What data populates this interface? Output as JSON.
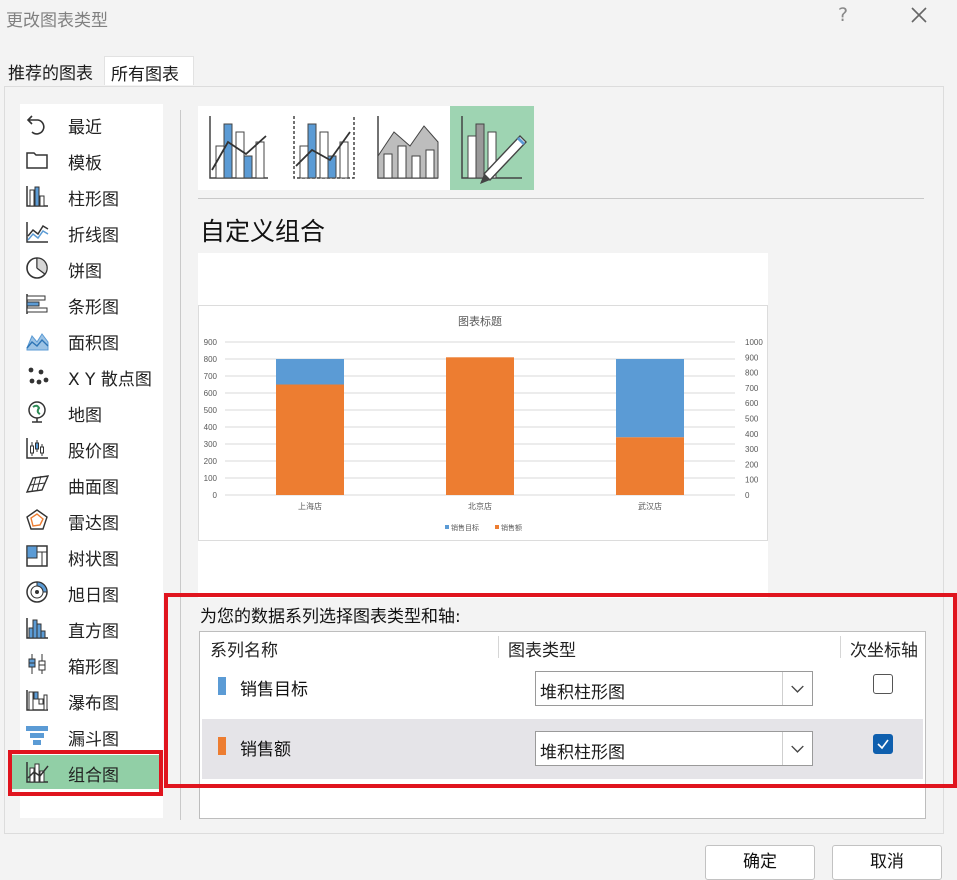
{
  "dialog": {
    "title": "更改图表类型",
    "help_label": "?"
  },
  "tabs": {
    "recommended": "推荐的图表",
    "all": "所有图表"
  },
  "categories": [
    {
      "label": "最近",
      "icon": "recent-icon"
    },
    {
      "label": "模板",
      "icon": "folder-icon"
    },
    {
      "label": "柱形图",
      "icon": "column-chart-icon"
    },
    {
      "label": "折线图",
      "icon": "line-chart-icon"
    },
    {
      "label": "饼图",
      "icon": "pie-chart-icon"
    },
    {
      "label": "条形图",
      "icon": "bar-chart-icon"
    },
    {
      "label": "面积图",
      "icon": "area-chart-icon"
    },
    {
      "label": "X Y 散点图",
      "icon": "scatter-chart-icon"
    },
    {
      "label": "地图",
      "icon": "map-chart-icon"
    },
    {
      "label": "股价图",
      "icon": "stock-chart-icon"
    },
    {
      "label": "曲面图",
      "icon": "surface-chart-icon"
    },
    {
      "label": "雷达图",
      "icon": "radar-chart-icon"
    },
    {
      "label": "树状图",
      "icon": "treemap-chart-icon"
    },
    {
      "label": "旭日图",
      "icon": "sunburst-chart-icon"
    },
    {
      "label": "直方图",
      "icon": "histogram-chart-icon"
    },
    {
      "label": "箱形图",
      "icon": "box-whisker-chart-icon"
    },
    {
      "label": "瀑布图",
      "icon": "waterfall-chart-icon"
    },
    {
      "label": "漏斗图",
      "icon": "funnel-chart-icon"
    },
    {
      "label": "组合图",
      "icon": "combo-chart-icon",
      "selected": true
    }
  ],
  "combo_types": [
    {
      "icon": "clustered-column-line-icon"
    },
    {
      "icon": "clustered-column-line-secondary-axis-icon"
    },
    {
      "icon": "stacked-area-clustered-column-icon"
    },
    {
      "icon": "custom-combination-icon",
      "selected": true
    }
  ],
  "section_title": "自定义组合",
  "chart_data": {
    "type": "bar",
    "stacked": true,
    "title": "图表标题",
    "categories": [
      "上海店",
      "北京店",
      "武汉店"
    ],
    "series": [
      {
        "name": "销售目标",
        "values": [
          150,
          0,
          460
        ],
        "color": "#5b9bd5"
      },
      {
        "name": "销售额",
        "values": [
          650,
          810,
          340
        ],
        "color": "#ed7d31"
      }
    ],
    "ylim": [
      0,
      900
    ],
    "yticks": [
      0,
      100,
      200,
      300,
      400,
      500,
      600,
      700,
      800,
      900
    ],
    "y2lim": [
      0,
      1000
    ],
    "y2ticks": [
      0,
      100,
      200,
      300,
      400,
      500,
      600,
      700,
      800,
      900,
      1000
    ],
    "grid": true,
    "legend": "bottom"
  },
  "series_panel": {
    "label": "为您的数据系列选择图表类型和轴:",
    "headers": {
      "name": "系列名称",
      "type": "图表类型",
      "axis": "次坐标轴"
    },
    "rows": [
      {
        "name": "销售目标",
        "color": "#5b9bd5",
        "chart_type": "堆积柱形图",
        "secondary_axis": false
      },
      {
        "name": "销售额",
        "color": "#ed7d31",
        "chart_type": "堆积柱形图",
        "secondary_axis": true
      }
    ]
  },
  "buttons": {
    "ok": "确定",
    "cancel": "取消"
  },
  "colors": {
    "selection": "#91cfa6",
    "highlight": "#e0141e",
    "checkbox": "#0f5fae"
  }
}
